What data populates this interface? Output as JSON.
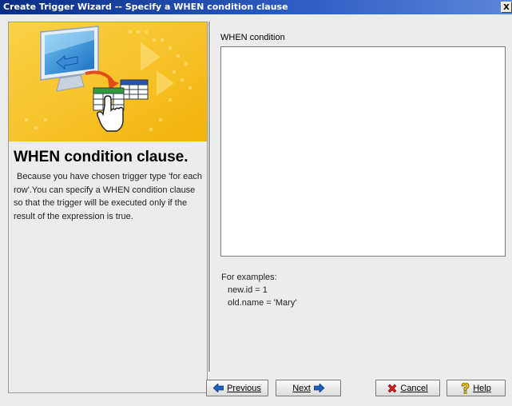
{
  "window": {
    "title": "Create Trigger Wizard -- Specify a WHEN condition clause",
    "close_label": "X"
  },
  "left_panel": {
    "heading": "WHEN condition clause.",
    "description": "Because you have chosen trigger type 'for each row'.You can specify a WHEN condition clause so that the trigger will be executed only if the result of the expression is true."
  },
  "main": {
    "when_condition_label": "WHEN condition",
    "when_condition_value": "",
    "examples_heading": "For examples:",
    "examples": [
      "new.id = 1",
      "old.name = 'Mary'"
    ]
  },
  "buttons": {
    "previous": "Previous",
    "next": "Next",
    "cancel": "Cancel",
    "help": "Help"
  },
  "colors": {
    "titlebar": "#0a2d84",
    "banner": "#f7c11c",
    "arrow_blue": "#1f5fc0",
    "cancel_red": "#d0201a",
    "help_yellow": "#f3c400"
  }
}
